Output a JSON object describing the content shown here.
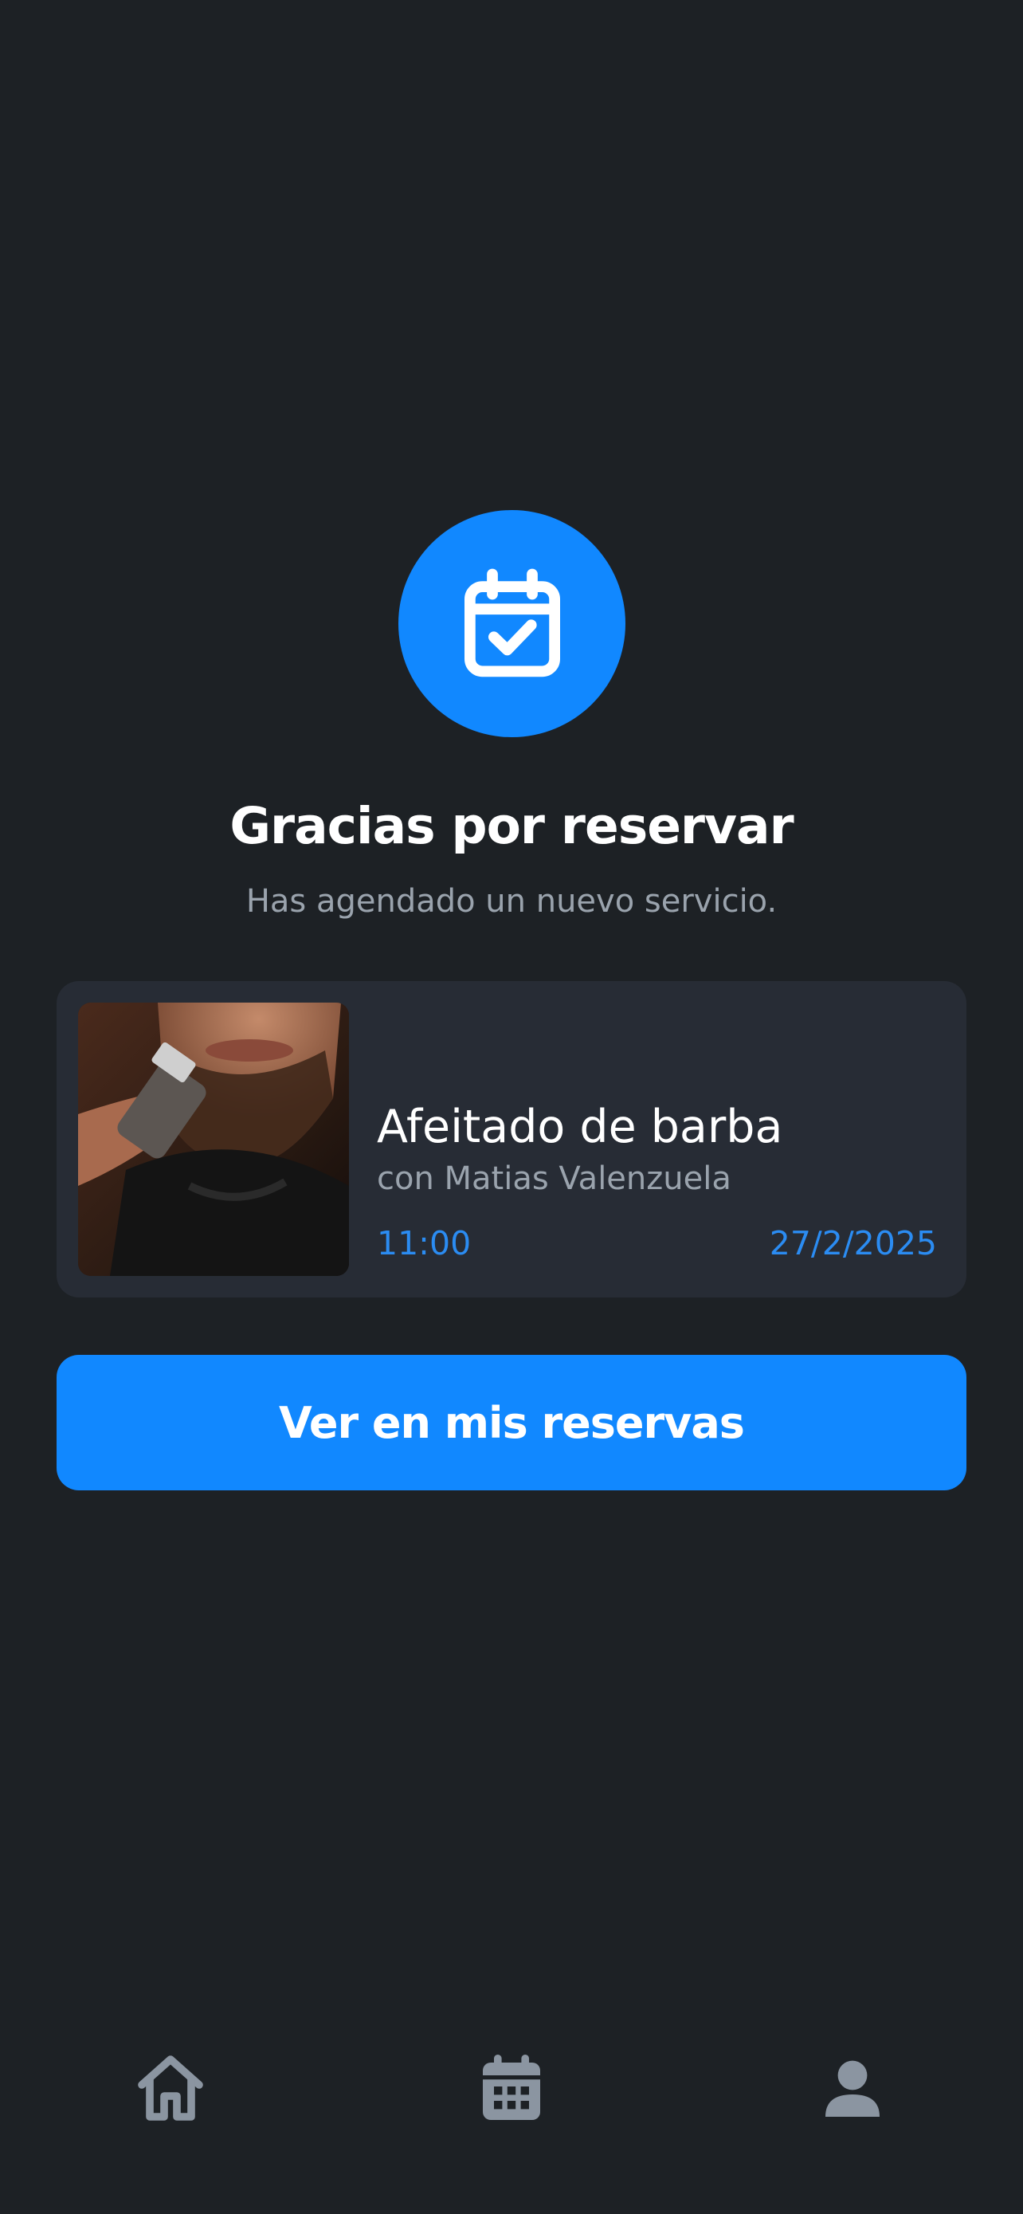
{
  "confirmation": {
    "icon": "calendar-check-icon",
    "title": "Gracias por reservar",
    "subtitle": "Has agendado un nuevo servicio."
  },
  "booking": {
    "image": "beard-trim-photo",
    "service": "Afeitado de barba",
    "barber": "con Matias Valenzuela",
    "time": "11:00",
    "date": "27/2/2025"
  },
  "actions": {
    "view_reservations_label": "Ver en mis reservas"
  },
  "tabbar": {
    "items": [
      {
        "icon": "home-icon"
      },
      {
        "icon": "calendar-icon"
      },
      {
        "icon": "profile-icon"
      }
    ]
  },
  "colors": {
    "background": "#1d2125",
    "card": "#272c35",
    "accent": "#1188ff",
    "muted_text": "#9aa3ad",
    "tab_icon": "#8b95a1"
  }
}
